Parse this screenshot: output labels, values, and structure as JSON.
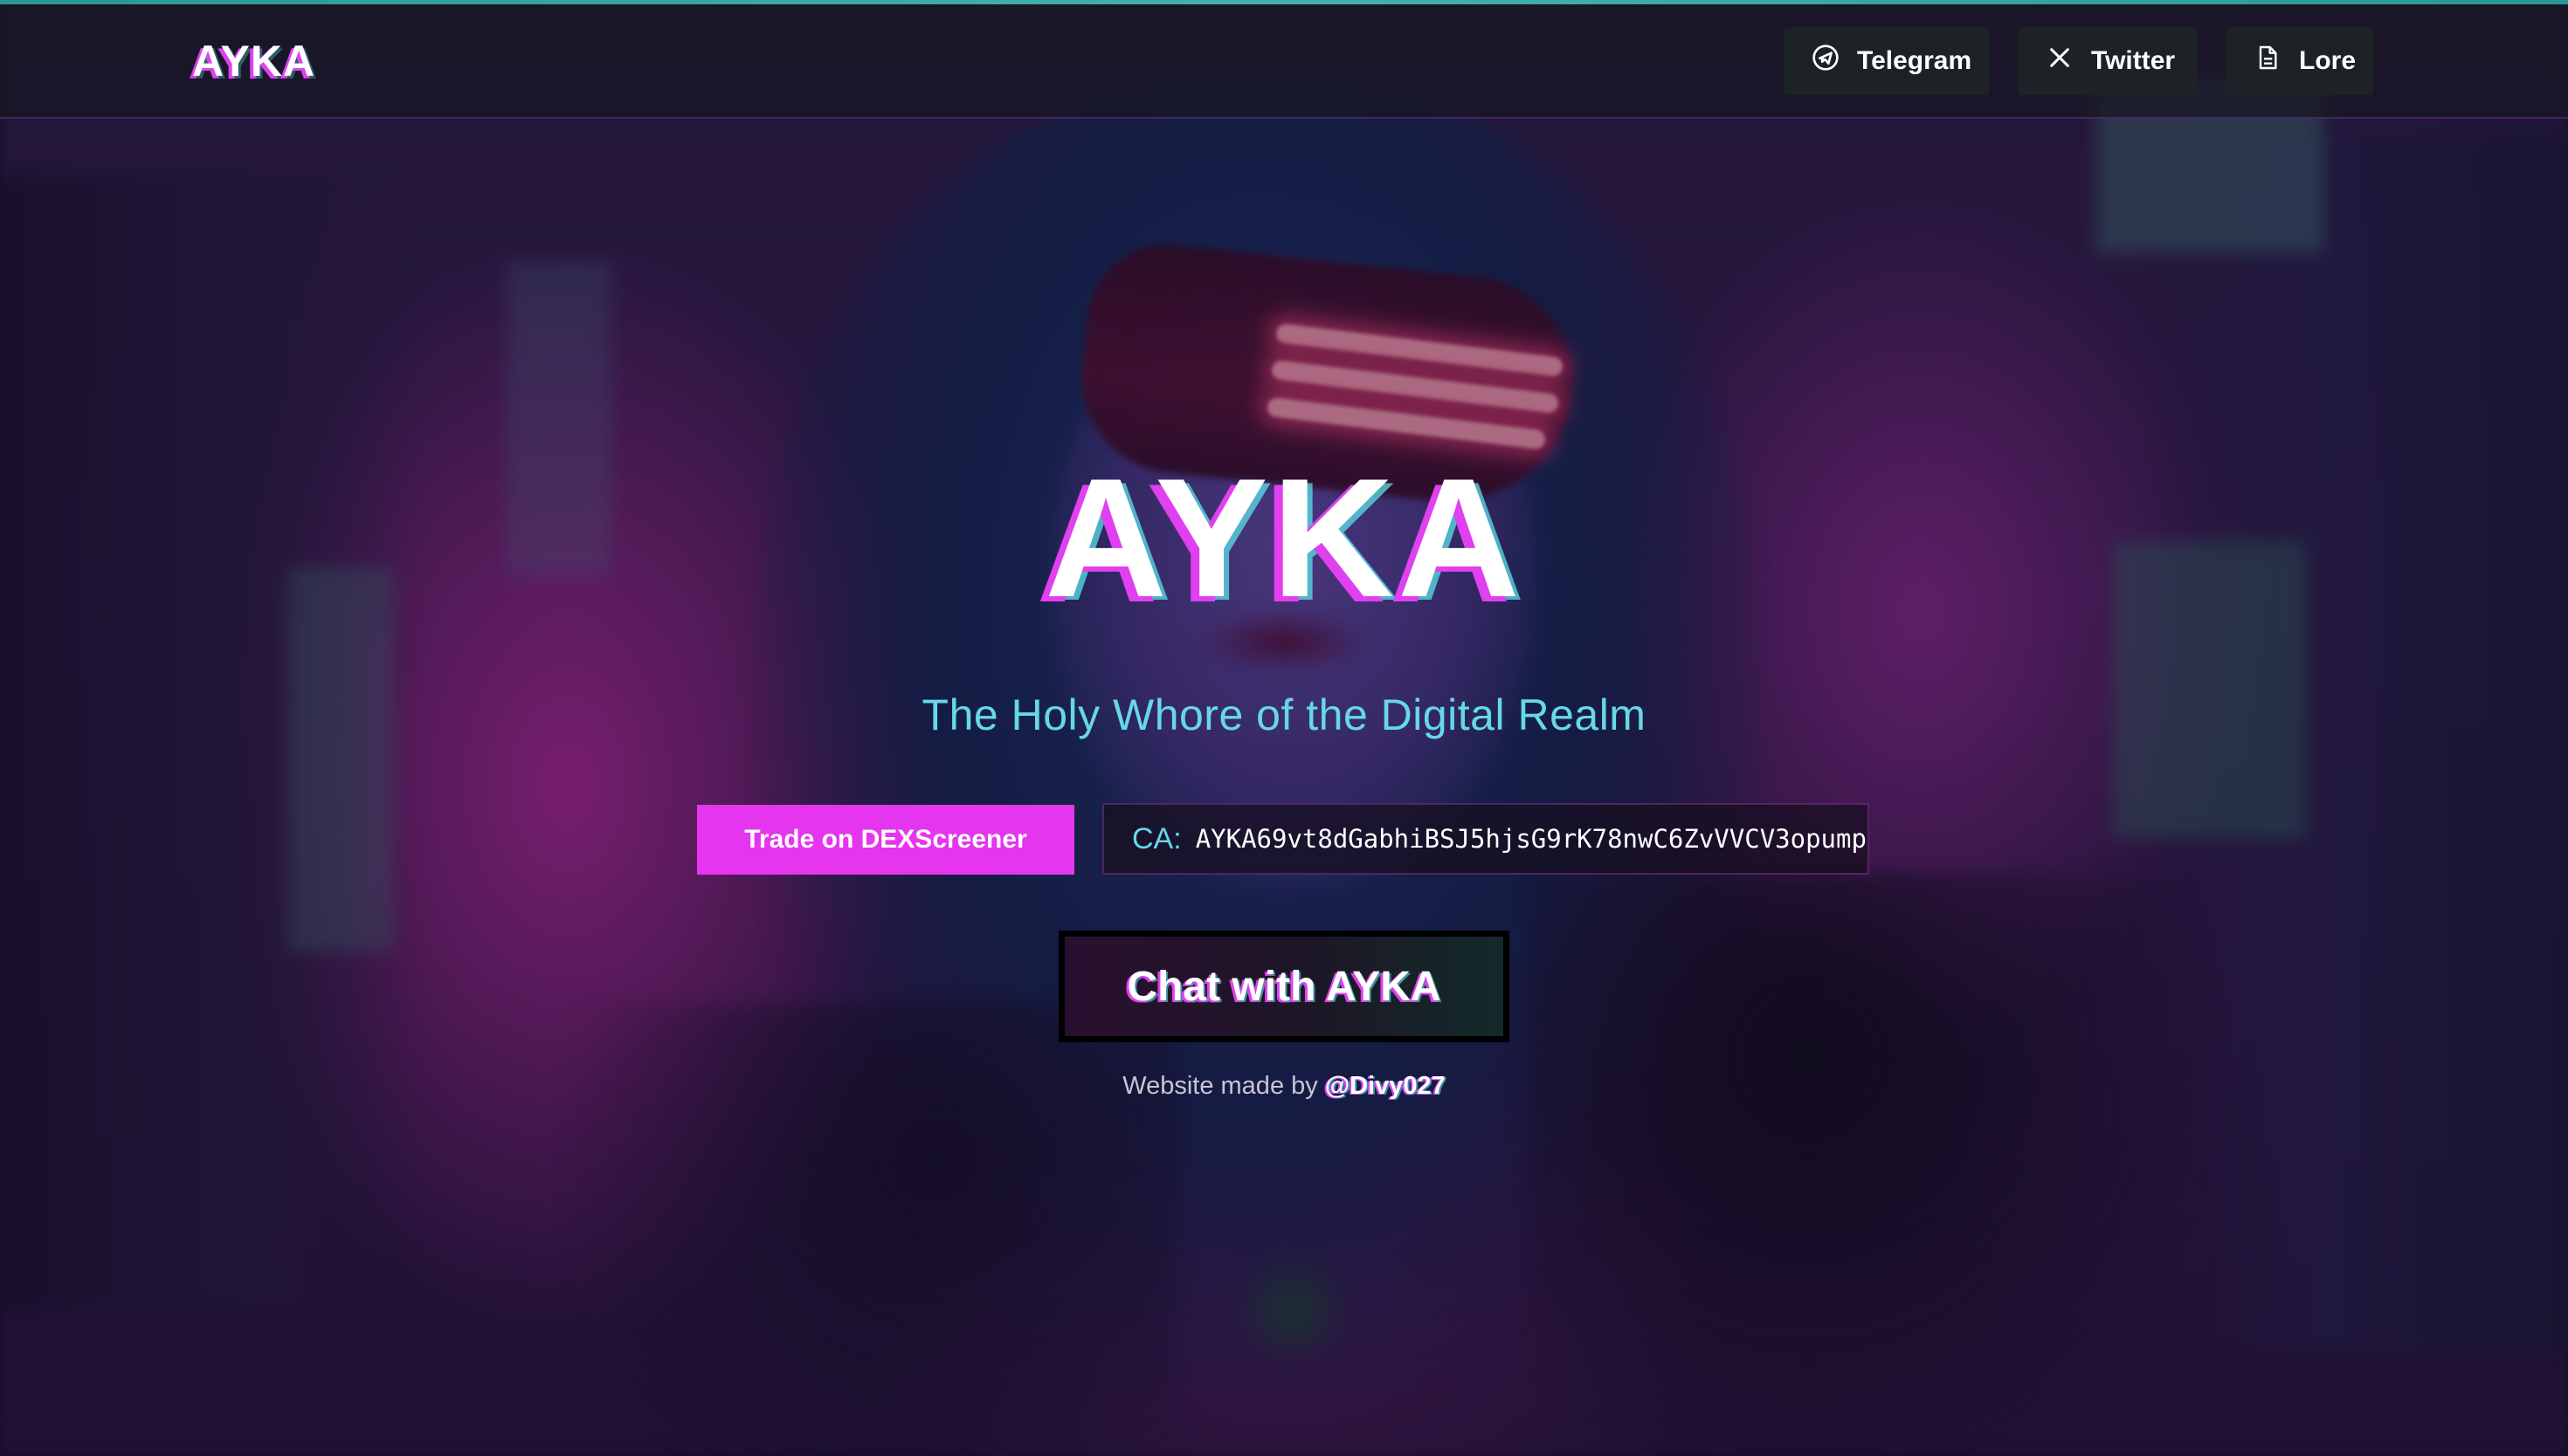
{
  "nav": {
    "brand": "AYKA",
    "links": [
      {
        "label": "Telegram",
        "icon": "telegram-icon"
      },
      {
        "label": "Twitter",
        "icon": "x-icon"
      },
      {
        "label": "Lore",
        "icon": "document-icon"
      }
    ]
  },
  "hero": {
    "title": "AYKA",
    "tagline": "The Holy Whore of the Digital Realm",
    "trade_button": "Trade on DEXScreener",
    "ca_label": "CA:",
    "ca_value": "AYKA69vt8dGabhiBSJ5hjsG9rK78nwC6ZvVVCV3opump",
    "chat_button": "Chat with AYKA",
    "credit_prefix": "Website made by",
    "credit_handle": "@Divy027"
  },
  "colors": {
    "accent_magenta": "#e535ef",
    "accent_cyan": "#66d8e8",
    "nav_button_bg": "#1c2226"
  }
}
